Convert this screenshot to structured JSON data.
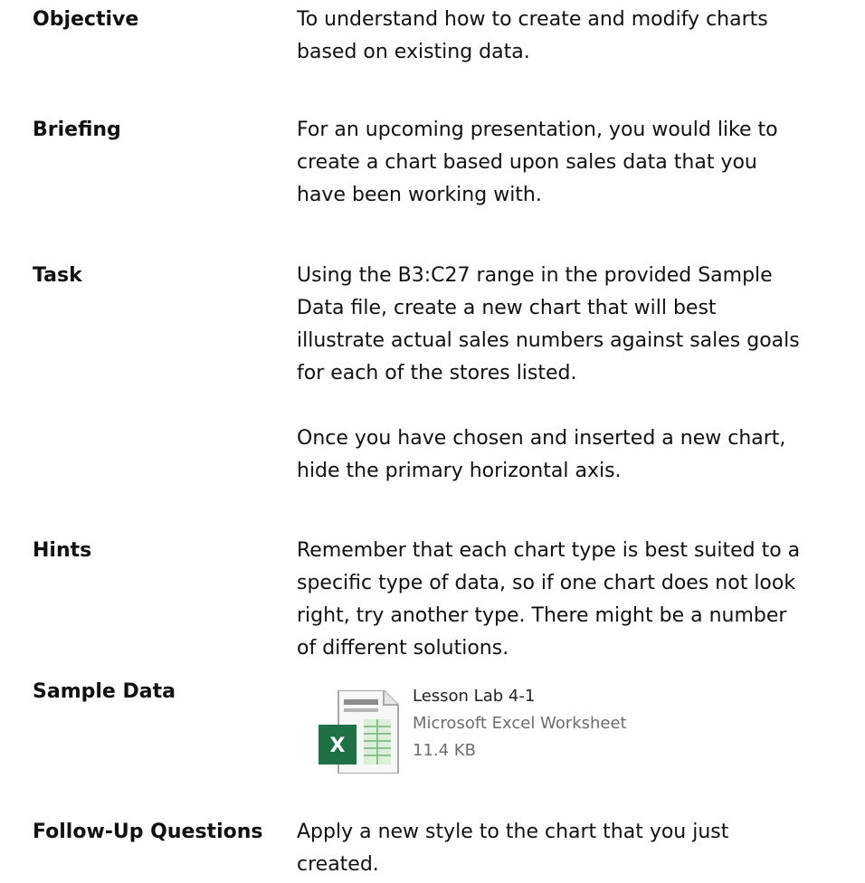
{
  "rows": {
    "objective": {
      "label": "Objective",
      "text": "To understand how to create and modify charts based on existing data."
    },
    "briefing": {
      "label": "Briefing",
      "text": "For an upcoming presentation, you would like to create a chart based upon sales data that you have been working with."
    },
    "task": {
      "label": "Task",
      "paragraph_1": "Using the B3:C27 range in the provided Sample Data file, create a new chart that will best illustrate actual sales numbers against sales goals for each of the stores listed.",
      "paragraph_2": "Once you have chosen and inserted a new chart, hide the primary horizontal axis."
    },
    "hints": {
      "label": "Hints",
      "text": "Remember that each chart type is best suited to a specific type of data, so if one chart does not look right, try another type. There might be a number of different solutions."
    },
    "sample_data": {
      "label": "Sample Data",
      "file": {
        "icon": "excel-file-icon",
        "name": "Lesson Lab 4-1",
        "type": "Microsoft Excel Worksheet",
        "size": "11.4 KB"
      }
    },
    "follow_up": {
      "label": "Follow-Up Questions",
      "text": "Apply a new style to the chart that you just created."
    }
  },
  "colors": {
    "excel_green": "#1e7145",
    "sheet_grid": "#8fbf8f"
  }
}
